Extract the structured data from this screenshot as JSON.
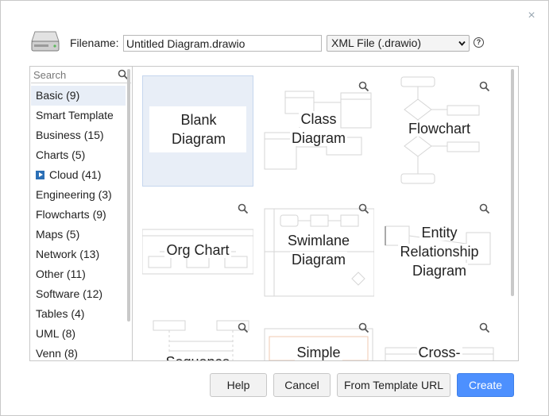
{
  "dialog": {
    "filename_label": "Filename:",
    "filename_value": "Untitled Diagram.drawio",
    "format_value": "XML File (.drawio)",
    "help_glyph": "?",
    "close_glyph": "×"
  },
  "sidebar": {
    "search_placeholder": "Search",
    "categories": [
      {
        "label": "Basic (9)",
        "active": true
      },
      {
        "label": "Smart Template"
      },
      {
        "label": "Business (15)"
      },
      {
        "label": "Charts (5)"
      },
      {
        "label": "Cloud (41)",
        "icon": "cloud-template-icon"
      },
      {
        "label": "Engineering (3)"
      },
      {
        "label": "Flowcharts (9)"
      },
      {
        "label": "Maps (5)"
      },
      {
        "label": "Network (13)"
      },
      {
        "label": "Other (11)"
      },
      {
        "label": "Software (12)"
      },
      {
        "label": "Tables (4)"
      },
      {
        "label": "UML (8)"
      },
      {
        "label": "Venn (8)"
      }
    ]
  },
  "templates": [
    {
      "line1": "Blank",
      "line2": "Diagram"
    },
    {
      "line1": "Class",
      "line2": "Diagram"
    },
    {
      "line1": "Flowchart",
      "line2": ""
    },
    {
      "line1": "Org Chart",
      "line2": ""
    },
    {
      "line1": "Swimlane",
      "line2": "Diagram"
    },
    {
      "line1": "Entity",
      "line2": "Relationship",
      "line3": "Diagram"
    },
    {
      "line1": "Sequence",
      "line2": ""
    },
    {
      "line1": "Simple",
      "line2": ""
    },
    {
      "line1": "Cross-",
      "line2": ""
    }
  ],
  "buttons": {
    "help": "Help",
    "cancel": "Cancel",
    "template_url": "From Template URL",
    "create": "Create"
  },
  "colors": {
    "accent": "#4d90fe",
    "selected_bg": "#e8eef7"
  }
}
